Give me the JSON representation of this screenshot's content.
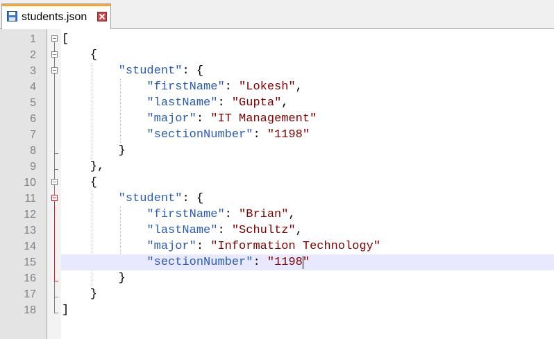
{
  "tab": {
    "filename": "students.json",
    "save_icon": "floppy-disk-icon",
    "close_icon": "close-icon"
  },
  "colors": {
    "key": "#2a5db0",
    "string": "#800000",
    "punct": "#000000",
    "current_line": "#e8e8ff",
    "fold_active": "#e02020",
    "fold_inactive": "#808080",
    "tab_accent": "#f6a52c"
  },
  "editor": {
    "current_line": 15,
    "lines": [
      {
        "n": "1",
        "tokens": [
          {
            "t": "[",
            "c": "p"
          }
        ]
      },
      {
        "n": "2",
        "tokens": [
          {
            "t": "    {",
            "c": "p"
          }
        ]
      },
      {
        "n": "3",
        "tokens": [
          {
            "t": "        ",
            "c": "p"
          },
          {
            "t": "\"student\"",
            "c": "k"
          },
          {
            "t": ": {",
            "c": "p"
          }
        ]
      },
      {
        "n": "4",
        "tokens": [
          {
            "t": "            ",
            "c": "p"
          },
          {
            "t": "\"firstName\"",
            "c": "k"
          },
          {
            "t": ": ",
            "c": "p"
          },
          {
            "t": "\"Lokesh\"",
            "c": "s"
          },
          {
            "t": ",",
            "c": "p"
          }
        ]
      },
      {
        "n": "5",
        "tokens": [
          {
            "t": "            ",
            "c": "p"
          },
          {
            "t": "\"lastName\"",
            "c": "k"
          },
          {
            "t": ": ",
            "c": "p"
          },
          {
            "t": "\"Gupta\"",
            "c": "s"
          },
          {
            "t": ",",
            "c": "p"
          }
        ]
      },
      {
        "n": "6",
        "tokens": [
          {
            "t": "            ",
            "c": "p"
          },
          {
            "t": "\"major\"",
            "c": "k"
          },
          {
            "t": ": ",
            "c": "p"
          },
          {
            "t": "\"IT Management\"",
            "c": "s"
          }
        ]
      },
      {
        "n": "7",
        "tokens": [
          {
            "t": "            ",
            "c": "p"
          },
          {
            "t": "\"sectionNumber\"",
            "c": "k"
          },
          {
            "t": ": ",
            "c": "p"
          },
          {
            "t": "\"1198\"",
            "c": "s"
          }
        ]
      },
      {
        "n": "8",
        "tokens": [
          {
            "t": "        }",
            "c": "p"
          }
        ]
      },
      {
        "n": "9",
        "tokens": [
          {
            "t": "    },",
            "c": "p"
          }
        ]
      },
      {
        "n": "10",
        "tokens": [
          {
            "t": "    {",
            "c": "p"
          }
        ]
      },
      {
        "n": "11",
        "tokens": [
          {
            "t": "        ",
            "c": "p"
          },
          {
            "t": "\"student\"",
            "c": "k"
          },
          {
            "t": ": {",
            "c": "p"
          }
        ]
      },
      {
        "n": "12",
        "tokens": [
          {
            "t": "            ",
            "c": "p"
          },
          {
            "t": "\"firstName\"",
            "c": "k"
          },
          {
            "t": ": ",
            "c": "p"
          },
          {
            "t": "\"Brian\"",
            "c": "s"
          },
          {
            "t": ",",
            "c": "p"
          }
        ]
      },
      {
        "n": "13",
        "tokens": [
          {
            "t": "            ",
            "c": "p"
          },
          {
            "t": "\"lastName\"",
            "c": "k"
          },
          {
            "t": ": ",
            "c": "p"
          },
          {
            "t": "\"Schultz\"",
            "c": "s"
          },
          {
            "t": ",",
            "c": "p"
          }
        ]
      },
      {
        "n": "14",
        "tokens": [
          {
            "t": "            ",
            "c": "p"
          },
          {
            "t": "\"major\"",
            "c": "k"
          },
          {
            "t": ": ",
            "c": "p"
          },
          {
            "t": "\"Information Technology\"",
            "c": "s"
          }
        ]
      },
      {
        "n": "15",
        "tokens": [
          {
            "t": "            ",
            "c": "p"
          },
          {
            "t": "\"sectionNumber\"",
            "c": "k"
          },
          {
            "t": ": ",
            "c": "p"
          },
          {
            "t": "\"1198\"",
            "c": "s"
          }
        ]
      },
      {
        "n": "16",
        "tokens": [
          {
            "t": "        }",
            "c": "p"
          }
        ]
      },
      {
        "n": "17",
        "tokens": [
          {
            "t": "    }",
            "c": "p"
          }
        ]
      },
      {
        "n": "18",
        "tokens": [
          {
            "t": "]",
            "c": "p"
          }
        ]
      }
    ]
  }
}
